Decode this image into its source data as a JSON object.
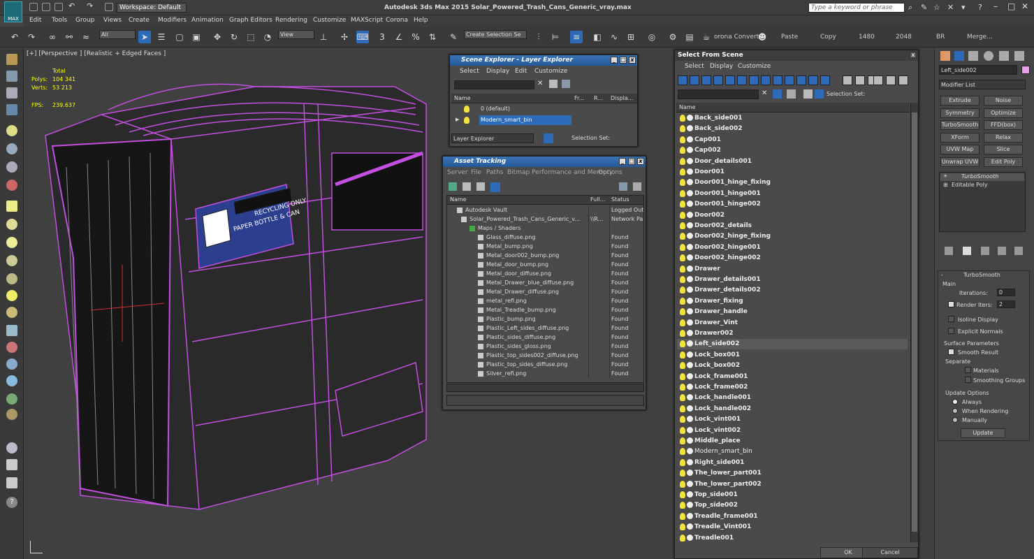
{
  "titlebar": {
    "logo": "MAX",
    "workspace": "Workspace: Default",
    "title": "Autodesk 3ds Max  2015    Solar_Powered_Trash_Cans_Generic_vray.max",
    "search_placeholder": "Type a keyword or phrase"
  },
  "menu": [
    "Edit",
    "Tools",
    "Group",
    "Views",
    "Create",
    "Modifiers",
    "Animation",
    "Graph Editors",
    "Rendering",
    "Customize",
    "MAXScript",
    "Corona",
    "Help"
  ],
  "toolbar": {
    "filter": "All",
    "refcoord": "View",
    "selection_set": "Create Selection Se",
    "corona": "orona Convert",
    "paste": "Paste",
    "copy": "Copy",
    "w": "1480",
    "h": "2048",
    "br": "BR",
    "merge": "Merge..."
  },
  "viewport": {
    "label": "[+] [Perspective ] [Realistic + Edged Faces ]",
    "total_label": "Total",
    "polys_label": "Polys:",
    "polys": "104 341",
    "verts_label": "Verts:",
    "verts": "53 213",
    "fps_label": "FPS:",
    "fps": "239.637",
    "sign_text": "PAPER BOTTLE & CAN",
    "sign_text2": "RECYCLING ONLY"
  },
  "scene_explorer": {
    "title": "Scene Explorer - Layer Explorer",
    "menu": [
      "Select",
      "Display",
      "Edit",
      "Customize"
    ],
    "cols": [
      "Name",
      "Fr...",
      "R...",
      "Displa..."
    ],
    "rows": [
      "0 (default)",
      "Modern_smart_bin"
    ],
    "footer_dd": "Layer Explorer",
    "footer_sel": "Selection Set:"
  },
  "asset_tracking": {
    "title": "Asset Tracking",
    "menu": [
      "Server",
      "File",
      "Paths",
      "Bitmap Performance and Memory",
      "Options"
    ],
    "cols": [
      "Name",
      "Full...",
      "Status"
    ],
    "rows": [
      {
        "name": "Autodesk Vault",
        "full": "",
        "status": "Logged Out..."
      },
      {
        "name": "Solar_Powered_Trash_Cans_Generic_v...",
        "full": "\\\\R...",
        "status": "Network Path"
      },
      {
        "name": "Maps / Shaders",
        "full": "",
        "status": ""
      },
      {
        "name": "Glass_diffuse.png",
        "full": "",
        "status": "Found"
      },
      {
        "name": "Metal_bump.png",
        "full": "",
        "status": "Found"
      },
      {
        "name": "Metal_door002_bump.png",
        "full": "",
        "status": "Found"
      },
      {
        "name": "Metal_door_bump.png",
        "full": "",
        "status": "Found"
      },
      {
        "name": "Metal_door_diffuse.png",
        "full": "",
        "status": "Found"
      },
      {
        "name": "Metal_Drawer_blue_diffuse.png",
        "full": "",
        "status": "Found"
      },
      {
        "name": "Metal_Drawer_diffuse.png",
        "full": "",
        "status": "Found"
      },
      {
        "name": "metal_refl.png",
        "full": "",
        "status": "Found"
      },
      {
        "name": "Metal_Treadle_bump.png",
        "full": "",
        "status": "Found"
      },
      {
        "name": "Plastic_bump.png",
        "full": "",
        "status": "Found"
      },
      {
        "name": "Plastic_Left_sides_diffuse.png",
        "full": "",
        "status": "Found"
      },
      {
        "name": "Plastic_sides_diffuse.png",
        "full": "",
        "status": "Found"
      },
      {
        "name": "Plastic_sides_gloss.png",
        "full": "",
        "status": "Found"
      },
      {
        "name": "Plastic_top_sides002_diffuse.png",
        "full": "",
        "status": "Found"
      },
      {
        "name": "Plastic_top_sides_diffuse.png",
        "full": "",
        "status": "Found"
      },
      {
        "name": "Silver_refl.png",
        "full": "",
        "status": "Found"
      }
    ]
  },
  "select_from_scene": {
    "title": "Select From Scene",
    "menu": [
      "Select",
      "Display",
      "Customize"
    ],
    "selection_set": "Selection Set:",
    "col_name": "Name",
    "items": [
      "Back_side001",
      "Back_side002",
      "Cap001",
      "Cap002",
      "Door_details001",
      "Door001",
      "Door001_hinge_fixing",
      "Door001_hinge001",
      "Door001_hinge002",
      "Door002",
      "Door002_details",
      "Door002_hinge_fixing",
      "Door002_hinge001",
      "Door002_hinge002",
      "Drawer",
      "Drawer_details001",
      "Drawer_details002",
      "Drawer_fixing",
      "Drawer_handle",
      "Drawer_Vint",
      "Drawer002",
      "Left_side002",
      "Lock_box001",
      "Lock_box002",
      "Lock_frame001",
      "Lock_frame002",
      "Lock_handle001",
      "Lock_handle002",
      "Lock_vint001",
      "Lock_vint002",
      "Middle_place",
      "Modern_smart_bin",
      "Right_side001",
      "The_lower_part001",
      "The_lower_part002",
      "Top_side001",
      "Top_side002",
      "Treadle_frame001",
      "Treadle_Vint001",
      "Treadle001"
    ],
    "selected": "Left_side002",
    "ok": "OK",
    "cancel": "Cancel"
  },
  "command_panel": {
    "object_name": "Left_side002",
    "modifier_list": "Modifier List",
    "buttons": [
      "Extrude",
      "Noise",
      "Symmetry",
      "Optimize",
      "TurboSmooth",
      "FFD(box)",
      "XForm",
      "Relax",
      "UVW Map",
      "Slice",
      "Unwrap UVW",
      "Edit Poly"
    ],
    "stack": [
      "TurboSmooth",
      "Editable Poly"
    ],
    "rollout_title": "TurboSmooth",
    "main_label": "Main",
    "iterations_label": "Iterations:",
    "iterations": "0",
    "render_iters_label": "Render Iters:",
    "render_iters": "2",
    "isoline": "Isoline Display",
    "explicit": "Explicit Normals",
    "surface_params": "Surface Parameters",
    "smooth_result": "Smooth Result",
    "separate": "Separate",
    "materials": "Materials",
    "smoothing_groups": "Smoothing Groups",
    "update_options": "Update Options",
    "always": "Always",
    "when_rendering": "When Rendering",
    "manually": "Manually",
    "update": "Update"
  },
  "colors": {
    "wire": "#c24fe0",
    "accent": "#2d6bb8",
    "bulb": "#f5e23a"
  }
}
